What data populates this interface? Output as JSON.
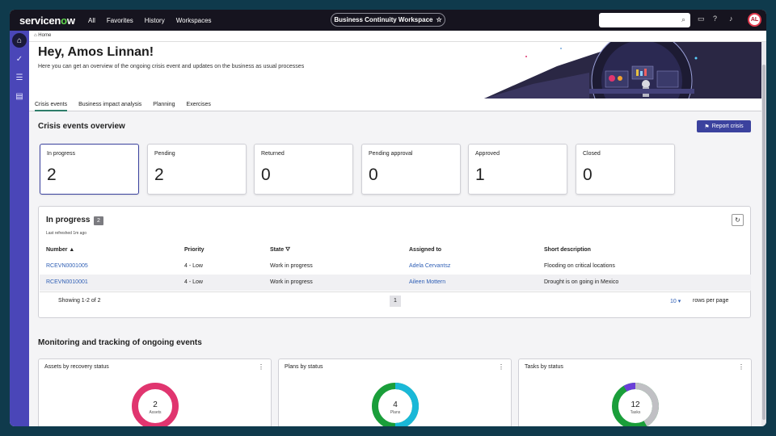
{
  "nav": {
    "logo_main": "servicen",
    "logo_o": "o",
    "logo_end": "w",
    "links": [
      "All",
      "Favorites",
      "History",
      "Workspaces"
    ],
    "workspace": "Business Continuity Workspace",
    "avatar": "AL"
  },
  "breadcrumb": "Home",
  "hero": {
    "greeting": "Hey, Amos Linnan!",
    "subtitle": "Here you can get an overview of the ongoing crisis event and updates on the business as usual processes"
  },
  "tabs": [
    "Crisis events",
    "Business impact analysis",
    "Planning",
    "Exercises"
  ],
  "overview": {
    "title": "Crisis events overview",
    "report_button": "Report crisis",
    "stats": [
      {
        "label": "In progress",
        "value": "2"
      },
      {
        "label": "Pending",
        "value": "2"
      },
      {
        "label": "Returned",
        "value": "0"
      },
      {
        "label": "Pending approval",
        "value": "0"
      },
      {
        "label": "Approved",
        "value": "1"
      },
      {
        "label": "Closed",
        "value": "0"
      }
    ]
  },
  "in_progress": {
    "title": "In progress",
    "count": "2",
    "refreshed": "Last refreshed 1m ago",
    "columns": [
      "Number",
      "Priority",
      "State",
      "Assigned to",
      "Short description"
    ],
    "rows": [
      {
        "number": "RCEVN0001005",
        "priority": "4 - Low",
        "state": "Work in progress",
        "assigned": "Adela Cervantsz",
        "desc": "Flooding on critical locations"
      },
      {
        "number": "RCEVN0010001",
        "priority": "4 - Low",
        "state": "Work in progress",
        "assigned": "Aileen Mottern",
        "desc": "Drought is on going in Mexico"
      }
    ],
    "showing": "Showing 1-2 of 2",
    "page": "1",
    "rows_per_page": "10",
    "rows_per_page_label": "rows per page"
  },
  "monitoring": {
    "title": "Monitoring and tracking of ongoing events",
    "cards": [
      {
        "title": "Assets by recovery status",
        "value": "2",
        "unit": "Assets"
      },
      {
        "title": "Plans by status",
        "value": "4",
        "unit": "Plans"
      },
      {
        "title": "Tasks by status",
        "value": "12",
        "unit": "Tasks"
      }
    ]
  },
  "colors": {
    "accent": "#3b429e",
    "sidebar": "#4a46b8",
    "assets_ring": "#e0356f",
    "plans_green": "#1a9e3a",
    "plans_cyan": "#1ab8d8",
    "tasks_green": "#1a9e3a",
    "tasks_gray": "#c0c0c4",
    "tasks_purple": "#6a3fd8"
  }
}
